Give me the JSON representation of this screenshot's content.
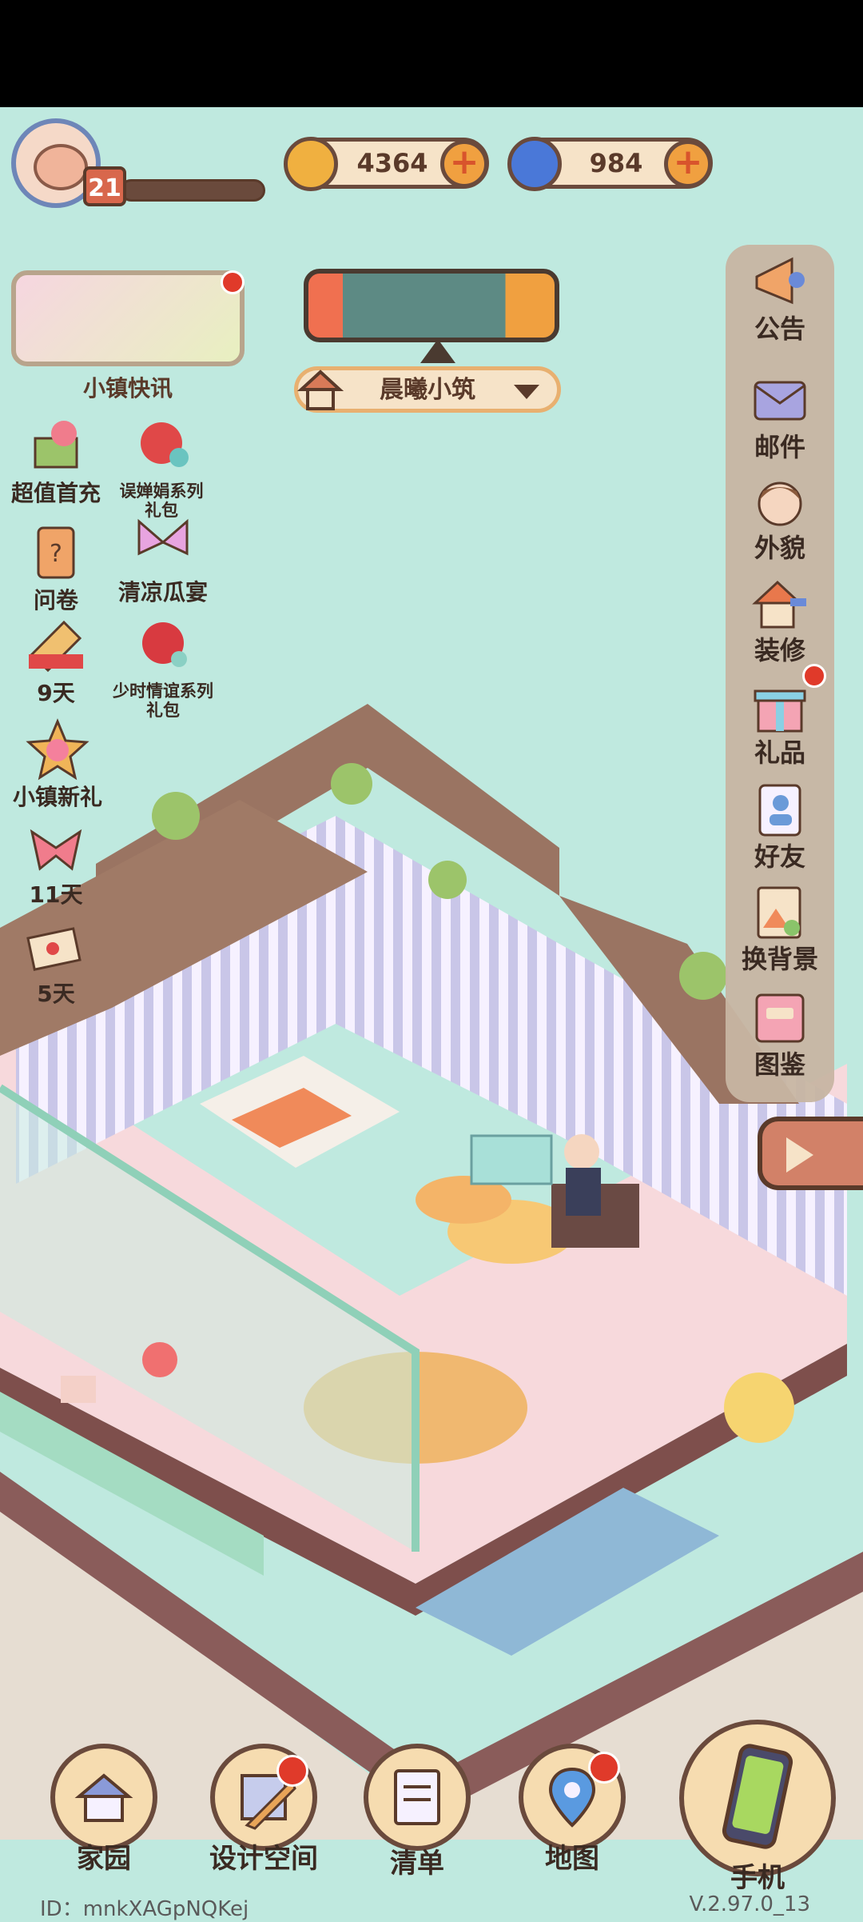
{
  "player": {
    "level": "21"
  },
  "currencies": [
    {
      "name": "coin",
      "value": "4364",
      "color": "#f0b040"
    },
    {
      "name": "gem",
      "value": "984",
      "color": "#4a78d8"
    }
  ],
  "news": {
    "label": "小镇快讯"
  },
  "home": {
    "name": "晨曦小筑"
  },
  "left_promos": [
    {
      "id": "first-recharge",
      "label": "超值首充"
    },
    {
      "id": "pack-1",
      "label": "误婵娟系列礼包"
    },
    {
      "id": "survey",
      "label": "问卷"
    },
    {
      "id": "melon-feast",
      "label": "清凉瓜宴"
    },
    {
      "id": "countdown-9",
      "label": "9天"
    },
    {
      "id": "pack-2",
      "label": "少时情谊系列礼包"
    },
    {
      "id": "new-gift",
      "label": "小镇新礼"
    },
    {
      "id": "countdown-11",
      "label": "11天"
    },
    {
      "id": "countdown-5",
      "label": "5天"
    }
  ],
  "side_menu": [
    {
      "id": "announce",
      "label": "公告",
      "icon": "megaphone-icon"
    },
    {
      "id": "mail",
      "label": "邮件",
      "icon": "envelope-icon"
    },
    {
      "id": "appearance",
      "label": "外貌",
      "icon": "face-icon"
    },
    {
      "id": "decorate",
      "label": "装修",
      "icon": "house-wrench-icon"
    },
    {
      "id": "gift",
      "label": "礼品",
      "icon": "gift-icon"
    },
    {
      "id": "friends",
      "label": "好友",
      "icon": "contacts-icon"
    },
    {
      "id": "background",
      "label": "换背景",
      "icon": "landscape-icon"
    },
    {
      "id": "collection",
      "label": "图鉴",
      "icon": "book-icon"
    }
  ],
  "bottom_nav": [
    {
      "id": "home",
      "label": "家园"
    },
    {
      "id": "design",
      "label": "设计空间"
    },
    {
      "id": "list",
      "label": "清单"
    },
    {
      "id": "map",
      "label": "地图"
    },
    {
      "id": "phone",
      "label": "手机"
    }
  ],
  "footer": {
    "id_text": "ID：mnkXAGpNQKej",
    "version": "V.2.97.0_13"
  }
}
